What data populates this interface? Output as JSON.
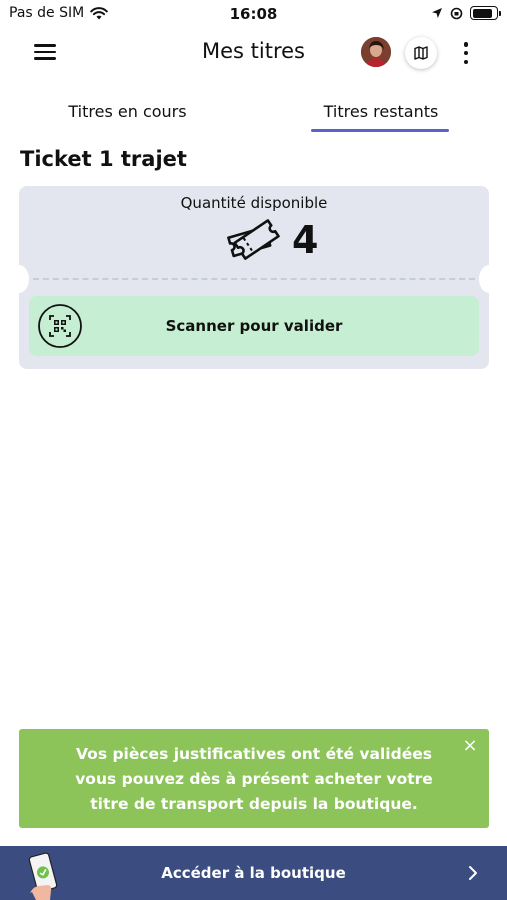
{
  "status_bar": {
    "carrier": "Pas de SIM",
    "time": "16:08",
    "battery_level": 0.85
  },
  "header": {
    "title": "Mes titres",
    "icons": [
      "menu-icon",
      "avatar",
      "map-icon",
      "more-vertical-icon"
    ]
  },
  "tabs": {
    "items": [
      {
        "label": "Titres en cours",
        "active": false
      },
      {
        "label": "Titres restants",
        "active": true
      }
    ],
    "active_color": "#5564c5"
  },
  "ticket": {
    "title": "Ticket 1 trajet",
    "quantity_label": "Quantité disponible",
    "quantity": "4",
    "scan_label": "Scanner pour valider",
    "card_color": "#e3e6ee",
    "scan_color": "#c6eed2"
  },
  "notice": {
    "message": "Vos pièces justificatives ont été validées vous pouvez dès à présent acheter votre titre de transport depuis la boutique.",
    "close": "×",
    "color": "#8cc45a"
  },
  "bottom_bar": {
    "label": "Accéder à la boutique",
    "color": "#3b4d80"
  }
}
